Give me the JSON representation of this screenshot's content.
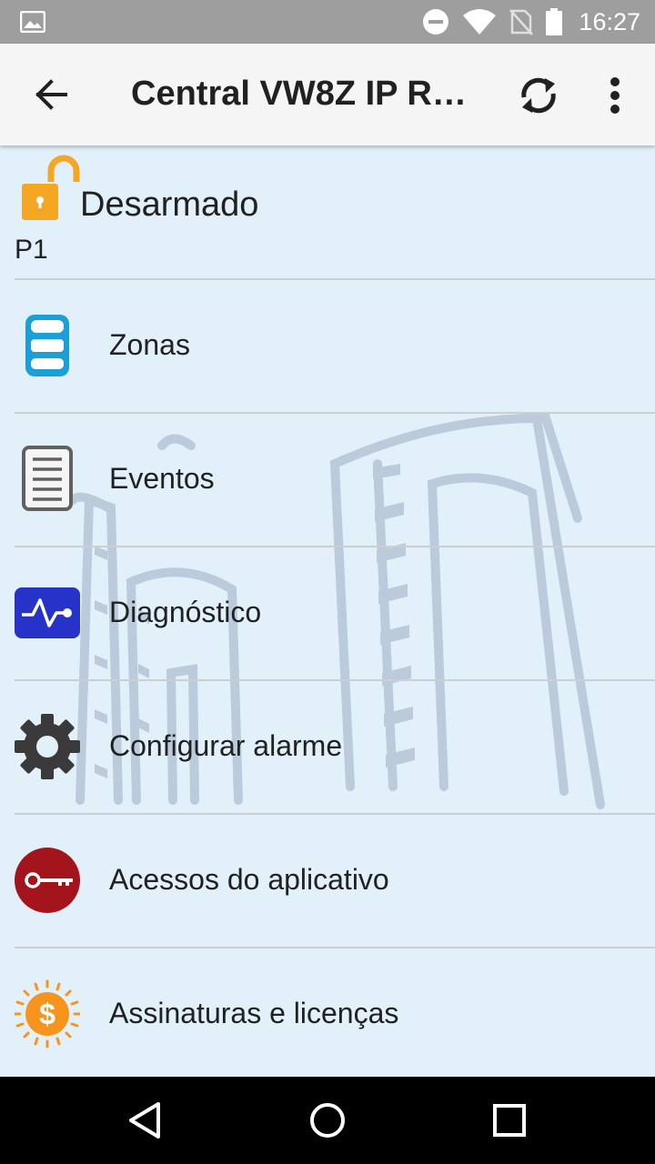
{
  "status_bar": {
    "time": "16:27",
    "icons": [
      "gallery-icon",
      "do-not-disturb-icon",
      "wifi-icon",
      "no-sim-icon",
      "battery-icon"
    ]
  },
  "app_bar": {
    "title": "Central VW8Z IP RF...",
    "back_icon": "arrow-back-icon",
    "sync_icon": "sync-icon",
    "more_icon": "more-vert-icon"
  },
  "alarm_status": {
    "state": "Desarmado",
    "partition": "P1",
    "icon": "unlocked-padlock-icon",
    "color": "#f5a623"
  },
  "menu": {
    "items": [
      {
        "label": "Zonas",
        "icon": "zones-cylinder-icon"
      },
      {
        "label": "Eventos",
        "icon": "events-document-icon"
      },
      {
        "label": "Diagnóstico",
        "icon": "diagnostic-pulse-icon"
      },
      {
        "label": "Configurar alarme",
        "icon": "gear-icon"
      },
      {
        "label": "Acessos do aplicativo",
        "icon": "key-icon"
      },
      {
        "label": "Assinaturas e licenças",
        "icon": "dollar-sun-icon"
      }
    ]
  },
  "colors": {
    "content_bg": "#e1f0f9",
    "zones_blue": "#1a9fd9",
    "diagnostic_blue": "#2632c8",
    "key_red": "#a3141c",
    "dollar_orange": "#f7941d"
  },
  "nav_bar": {
    "buttons": [
      "back-triangle-icon",
      "home-circle-icon",
      "recents-square-icon"
    ]
  }
}
